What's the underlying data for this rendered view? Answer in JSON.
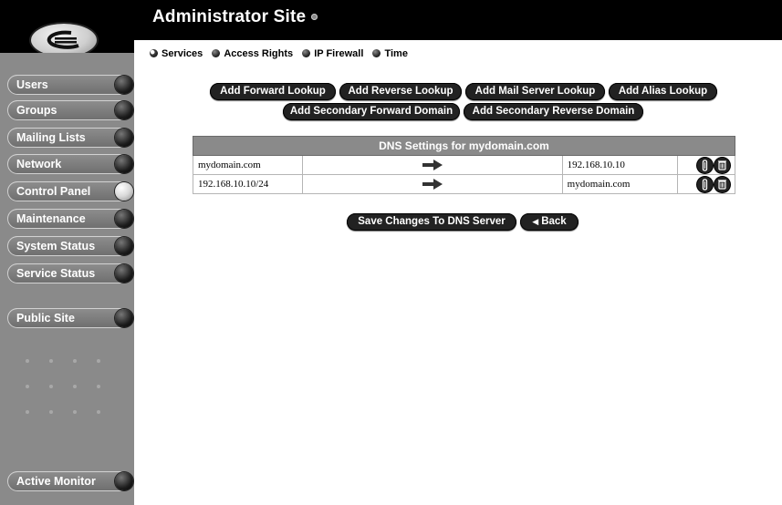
{
  "header": {
    "title": "Administrator Site"
  },
  "sidebar": {
    "items": [
      {
        "label": "Users",
        "icon": "ball-indicator",
        "active": false
      },
      {
        "label": "Groups",
        "icon": "ball-indicator",
        "active": false
      },
      {
        "label": "Mailing Lists",
        "icon": "ball-indicator",
        "active": false
      },
      {
        "label": "Network",
        "icon": "ball-indicator",
        "active": false
      },
      {
        "label": "Control Panel",
        "icon": "ball-indicator",
        "active": true
      },
      {
        "label": "Maintenance",
        "icon": "ball-indicator",
        "active": false
      },
      {
        "label": "System Status",
        "icon": "ball-indicator",
        "active": false
      },
      {
        "label": "Service Status",
        "icon": "ball-indicator",
        "active": false
      },
      {
        "label": "Public Site",
        "icon": "ball-indicator",
        "active": false
      },
      {
        "label": "Active Monitor",
        "icon": "ball-indicator",
        "active": false
      }
    ]
  },
  "subnav": {
    "items": [
      {
        "label": "Services",
        "active": true
      },
      {
        "label": "Access Rights",
        "active": false
      },
      {
        "label": "IP Firewall",
        "active": false
      },
      {
        "label": "Time",
        "active": false
      }
    ]
  },
  "actions": {
    "add_forward_lookup": "Add Forward Lookup",
    "add_reverse_lookup": "Add Reverse Lookup",
    "add_mail_server_lookup": "Add Mail Server Lookup",
    "add_alias_lookup": "Add Alias Lookup",
    "add_secondary_forward_domain": "Add Secondary Forward Domain",
    "add_secondary_reverse_domain": "Add Secondary Reverse Domain"
  },
  "dns_table": {
    "title": "DNS Settings for mydomain.com",
    "rows": [
      {
        "source": "mydomain.com",
        "arrow_icon": "right-arrow-icon",
        "target": "192.168.10.10",
        "modify_icon": "modify-icon",
        "delete_icon": "trash-icon"
      },
      {
        "source": "192.168.10.10/24",
        "arrow_icon": "right-arrow-icon",
        "target": "mydomain.com",
        "modify_icon": "modify-icon",
        "delete_icon": "trash-icon"
      }
    ]
  },
  "footer_actions": {
    "save": "Save Changes To DNS Server",
    "back": "Back",
    "back_icon": "left-triangle-icon"
  },
  "colors": {
    "sidebar_bg": "#8a8a8a",
    "header_bg": "#000000",
    "button_bg": "#222222",
    "table_header_bg": "#8a8a8a"
  }
}
